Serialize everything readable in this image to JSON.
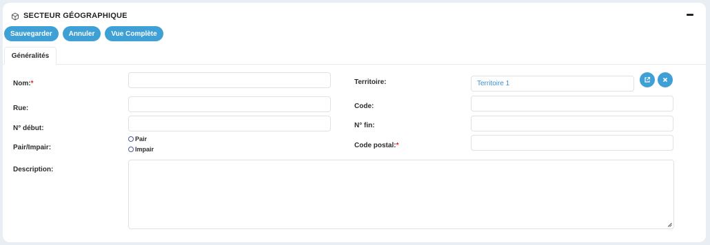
{
  "header": {
    "title": "SECTEUR GÉOGRAPHIQUE",
    "icon": "cube-icon",
    "collapse_icon": "minus-icon"
  },
  "toolbar": {
    "save_label": "Sauvegarder",
    "cancel_label": "Annuler",
    "full_view_label": "Vue Complète"
  },
  "tabs": [
    {
      "label": "Généralités",
      "active": true
    }
  ],
  "form": {
    "nom": {
      "label": "Nom:",
      "required": "*",
      "value": ""
    },
    "rue": {
      "label": "Rue:",
      "value": ""
    },
    "num_debut": {
      "label": "N° début:",
      "value": ""
    },
    "pair_impair": {
      "label": "Pair/Impair:",
      "options": [
        "Pair",
        "Impair"
      ],
      "selected": ""
    },
    "description": {
      "label": "Description:",
      "value": ""
    },
    "territoire": {
      "label": "Territoire:",
      "value": "Territoire 1"
    },
    "code": {
      "label": "Code:",
      "value": ""
    },
    "num_fin": {
      "label": "N° fin:",
      "value": ""
    },
    "code_postal": {
      "label": "Code postal:",
      "required": "*",
      "value": ""
    }
  },
  "colors": {
    "accent": "#3ea0d4",
    "link": "#3a8fcf",
    "required": "#d9262a",
    "background": "#e8eef3"
  }
}
